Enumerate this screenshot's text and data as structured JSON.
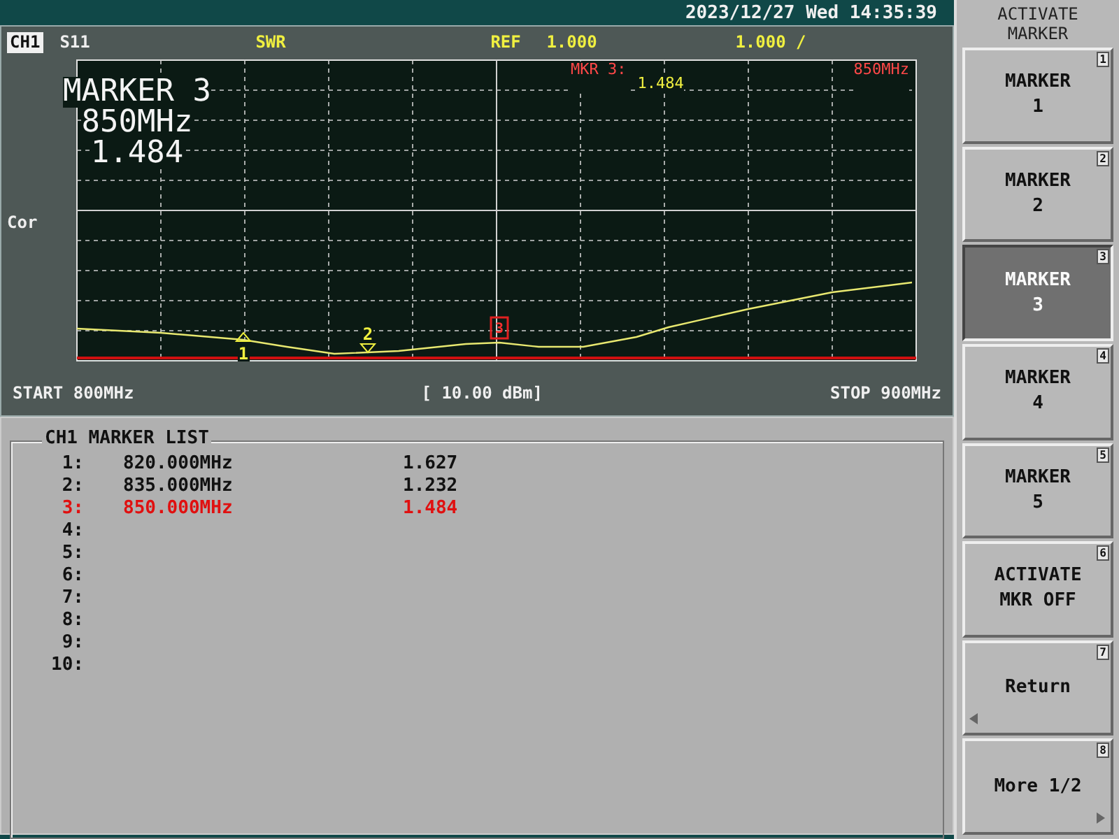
{
  "status_bar": {
    "datetime": "2023/12/27 Wed 14:35:39"
  },
  "channel_header": {
    "channel": "CH1",
    "parameter": "S11",
    "format": "SWR",
    "ref_label": "REF",
    "ref_value": "1.000",
    "scale": "1.000 /"
  },
  "side_label": "Cor",
  "marker_readout": {
    "label": "MKR 3:",
    "value": "1.484",
    "frequency": "850MHz"
  },
  "big_readout": [
    "MARKER 3",
    "850MHz",
    "1.484"
  ],
  "trace_markers": [
    {
      "label": "1",
      "selected": false
    },
    {
      "label": "2",
      "selected": false
    },
    {
      "label": "3",
      "selected": true
    }
  ],
  "footer": {
    "start": "START 800MHz",
    "power": "[ 10.00 dBm]",
    "stop": "STOP 900MHz"
  },
  "marker_list": {
    "title": "CH1 MARKER LIST",
    "rows": [
      {
        "index": "1:",
        "frequency": "820.000MHz",
        "value": "1.627",
        "selected": false
      },
      {
        "index": "2:",
        "frequency": "835.000MHz",
        "value": "1.232",
        "selected": false
      },
      {
        "index": "3:",
        "frequency": "850.000MHz",
        "value": "1.484",
        "selected": true
      },
      {
        "index": "4:",
        "selected": false
      },
      {
        "index": "5:",
        "selected": false
      },
      {
        "index": "6:",
        "selected": false
      },
      {
        "index": "7:",
        "selected": false
      },
      {
        "index": "8:",
        "selected": false
      },
      {
        "index": "9:",
        "selected": false
      },
      {
        "index": "10:",
        "selected": false
      }
    ]
  },
  "softkey_menu": {
    "title": [
      "ACTIVATE",
      "MARKER"
    ],
    "keys": [
      {
        "lines": [
          "MARKER",
          "1"
        ],
        "number": "1",
        "selected": false,
        "kind": "plain"
      },
      {
        "lines": [
          "MARKER",
          "2"
        ],
        "number": "2",
        "selected": false,
        "kind": "plain"
      },
      {
        "lines": [
          "MARKER",
          "3"
        ],
        "number": "3",
        "selected": true,
        "kind": "plain"
      },
      {
        "lines": [
          "MARKER",
          "4"
        ],
        "number": "4",
        "selected": false,
        "kind": "plain"
      },
      {
        "lines": [
          "MARKER",
          "5"
        ],
        "number": "5",
        "selected": false,
        "kind": "plain"
      },
      {
        "lines": [
          "ACTIVATE",
          "MKR OFF"
        ],
        "number": "6",
        "selected": false,
        "kind": "plain"
      },
      {
        "lines": [
          "Return"
        ],
        "number": "7",
        "selected": false,
        "kind": "back"
      },
      {
        "lines": [
          "More 1/2"
        ],
        "number": "8",
        "selected": false,
        "kind": "forward"
      }
    ]
  }
}
